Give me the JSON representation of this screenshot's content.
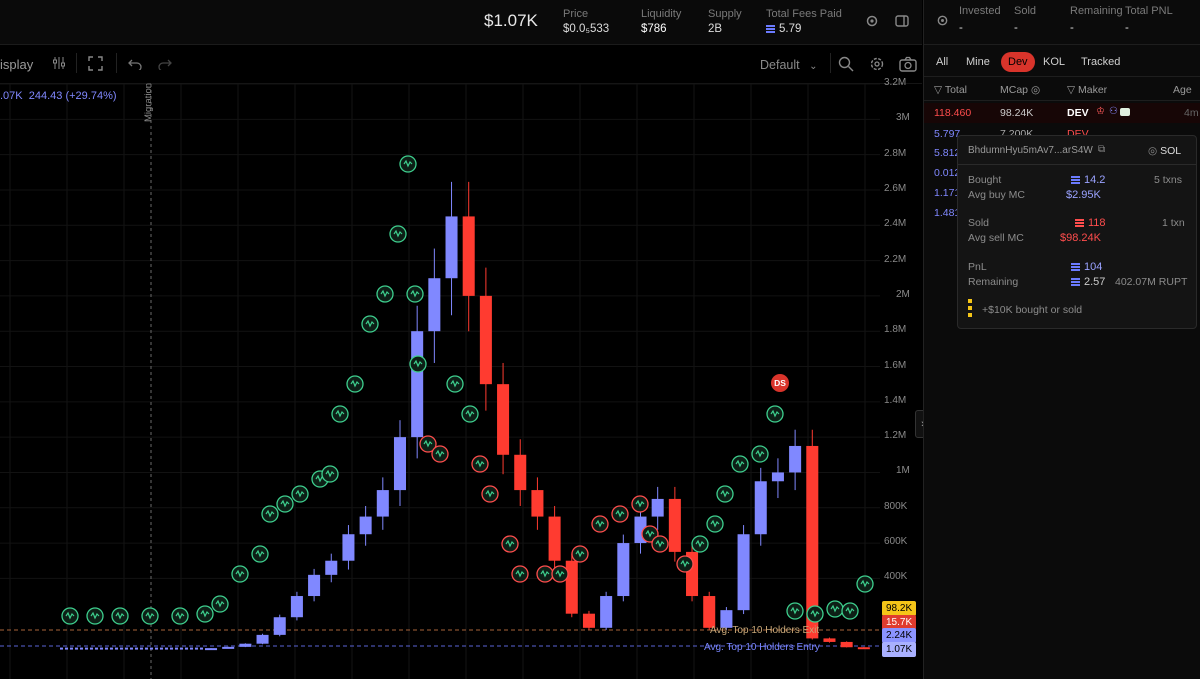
{
  "header": {
    "price_big": "$1.07K",
    "stats": [
      {
        "label": "Price",
        "value": "$0.0₅533"
      },
      {
        "label": "Liquidity",
        "value": "$786"
      },
      {
        "label": "Supply",
        "value": "2B"
      },
      {
        "label": "Total Fees Paid",
        "value": "5.79"
      }
    ],
    "icons": [
      "gear-icon",
      "panel-icon"
    ]
  },
  "toolbar": {
    "display_label": "isplay",
    "preset_label": "Default",
    "icons": [
      "indicators-icon",
      "fullscreen-icon",
      "undo-icon",
      "redo-icon",
      "search-icon",
      "settings-icon",
      "camera-icon"
    ]
  },
  "chart": {
    "ohlc_text": ".07K",
    "change_text": "244.43 (+29.74%)",
    "migration_label": "Migration",
    "y_ticks": [
      "3.2M",
      "3M",
      "2.8M",
      "2.6M",
      "2.4M",
      "2.2M",
      "2M",
      "1.8M",
      "1.6M",
      "1.4M",
      "1.2M",
      "1M",
      "800K",
      "600K",
      "400K"
    ],
    "line_labels": {
      "exit": "Avg. Top 10 Holders Exit",
      "entry": "Avg. Top 10 Holders Entry"
    },
    "price_tags": [
      {
        "text": "98.2K",
        "bg": "#f5c518",
        "fg": "#000000"
      },
      {
        "text": "15.7K",
        "bg": "#e03b2e",
        "fg": "#ffffff"
      },
      {
        "text": "2.24K",
        "bg": "#8b93ff",
        "fg": "#000000"
      },
      {
        "text": "1.07K",
        "bg": "#a9b0ff",
        "fg": "#000000"
      }
    ],
    "ds_marker": "DS",
    "colors": {
      "up": "#8088ff",
      "down": "#ff3b30",
      "marker": "#3ecf8e"
    }
  },
  "chart_data": {
    "type": "candlestick",
    "title": "",
    "ylim": [
      0,
      3200000
    ],
    "y_unit": "market cap (USD)",
    "closes_approx": [
      5000,
      12000,
      30000,
      80000,
      180000,
      300000,
      420000,
      500000,
      650000,
      750000,
      900000,
      1200000,
      1800000,
      2100000,
      2450000,
      2000000,
      1500000,
      1100000,
      900000,
      750000,
      500000,
      200000,
      120000,
      300000,
      600000,
      750000,
      850000,
      550000,
      300000,
      120000,
      220000,
      650000,
      950000,
      1000000,
      1150000,
      60000,
      40000,
      10000,
      1070
    ]
  },
  "panel": {
    "header": {
      "cols": [
        {
          "label": "Invested",
          "value": "-"
        },
        {
          "label": "Sold",
          "value": "-"
        },
        {
          "label": "Remaining",
          "value": "-"
        },
        {
          "label": "Total PNL",
          "value": "-"
        }
      ]
    },
    "tabs": [
      "All",
      "Mine",
      "Dev",
      "KOL",
      "Tracked"
    ],
    "active_tab": "Dev",
    "table_headers": [
      "Total",
      "MCap",
      "Maker",
      "Age"
    ],
    "rows": [
      {
        "total": "118.460",
        "mcap": "98.24K",
        "maker": "DEV",
        "age": "4m"
      },
      {
        "total": "5.797",
        "mcap": "7.200K",
        "maker": "DEV",
        "age": ""
      },
      {
        "total": "5.812",
        "mcap": "",
        "maker": "",
        "age": ""
      },
      {
        "total": "0.012",
        "mcap": "",
        "maker": "",
        "age": ""
      },
      {
        "total": "1.171",
        "mcap": "",
        "maker": "",
        "age": ""
      },
      {
        "total": "1.481",
        "mcap": "",
        "maker": "",
        "age": ""
      }
    ],
    "popup": {
      "wallet": "BhdumnHyu5mAv7...arS4W",
      "chain": "SOL",
      "bought_label": "Bought",
      "bought": "14.2",
      "bought_txns": "5 txns",
      "avg_buy_label": "Avg buy MC",
      "avg_buy": "$2.95K",
      "sold_label": "Sold",
      "sold": "118",
      "sold_txns": "1 txn",
      "avg_sell_label": "Avg sell MC",
      "avg_sell": "$98.24K",
      "pnl_label": "PnL",
      "pnl": "104",
      "remaining_label": "Remaining",
      "remaining": "2.57",
      "remaining_tokens": "402.07M RUPT",
      "legend": "+$10K bought or sold"
    }
  }
}
